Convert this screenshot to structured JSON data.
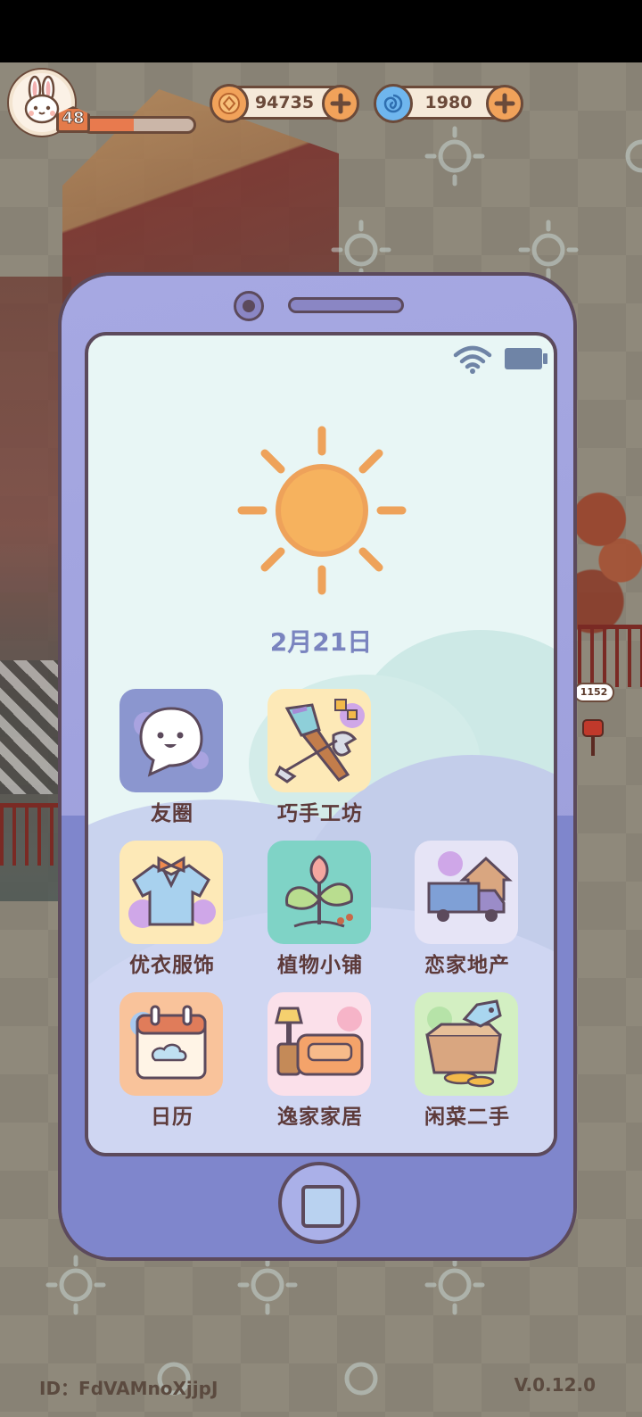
{
  "hud": {
    "level": "48",
    "xp_progress": 0.45,
    "coins": "94735",
    "gems": "1980"
  },
  "scene": {
    "price_bubble": "1152"
  },
  "phone": {
    "weather_icon": "sun-icon",
    "date": "2月21日",
    "apps": [
      {
        "label": "友圈",
        "icon": "chat-bubble-icon"
      },
      {
        "label": "巧手工坊",
        "icon": "paintbrush-wrench-icon"
      },
      {
        "label": "优衣服饰",
        "icon": "shirt-icon"
      },
      {
        "label": "植物小铺",
        "icon": "plant-icon"
      },
      {
        "label": "恋家地产",
        "icon": "truck-house-icon"
      },
      {
        "label": "日历",
        "icon": "calendar-icon"
      },
      {
        "label": "逸家家居",
        "icon": "sofa-lamp-icon"
      },
      {
        "label": "闲菜二手",
        "icon": "box-tag-icon"
      }
    ]
  },
  "footer": {
    "player_id": "ID：FdVAMnoXjjpJ",
    "version": "V.0.12.0"
  },
  "colors": {
    "phone_body": "#9595d8",
    "screen_bg": "#e8f6f5",
    "label_text": "#5d3a3a",
    "date_text": "#7a84bf",
    "outline": "#5c4a5c"
  }
}
